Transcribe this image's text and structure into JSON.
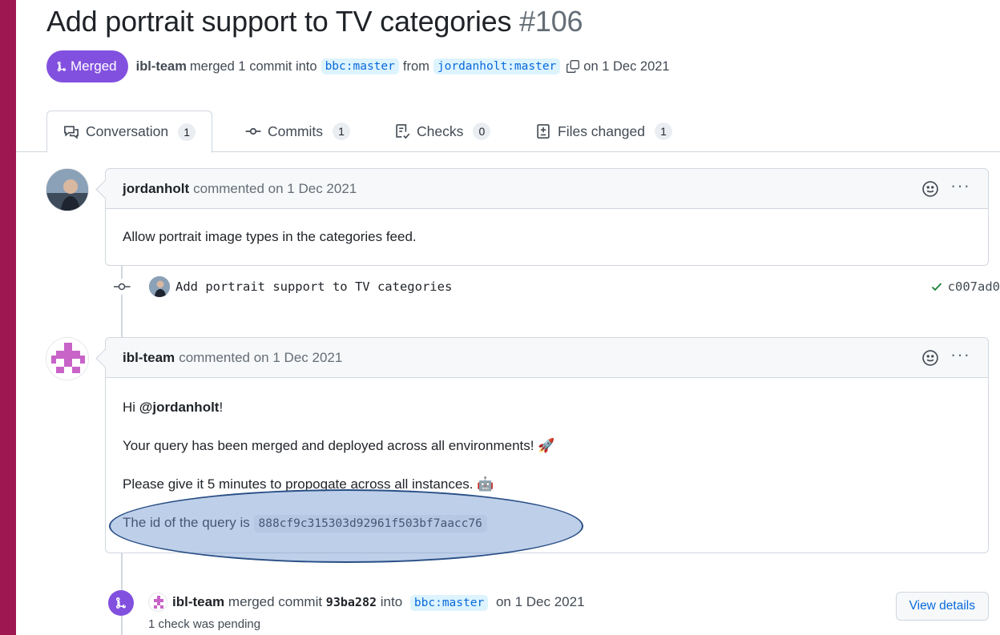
{
  "pr": {
    "title": "Add portrait support to TV categories",
    "number": "#106",
    "state": "Merged",
    "author": "ibl-team",
    "merge_text": "merged 1 commit into",
    "base_branch": "bbc:master",
    "from_text": "from",
    "head_branch": "jordanholt:master",
    "date_text": "on 1 Dec 2021"
  },
  "tabs": [
    {
      "label": "Conversation",
      "count": "1"
    },
    {
      "label": "Commits",
      "count": "1"
    },
    {
      "label": "Checks",
      "count": "0"
    },
    {
      "label": "Files changed",
      "count": "1"
    }
  ],
  "comment1": {
    "author": "jordanholt",
    "meta": "commented on 1 Dec 2021",
    "body": "Allow portrait image types in the categories feed."
  },
  "commit": {
    "message": "Add portrait support to TV categories",
    "sha": "c007ad0",
    "status_color": "#1a7f37"
  },
  "comment2": {
    "author": "ibl-team",
    "meta": "commented on 1 Dec 2021",
    "greeting_prefix": "Hi ",
    "mention": "@jordanholt",
    "greeting_suffix": "!",
    "line2": "Your query has been merged and deployed across all environments!",
    "line2_emoji": "🚀",
    "line3": "Please give it 5 minutes to propogate across all instances.",
    "line3_emoji": "🤖",
    "line4_prefix": "The id of the query is",
    "query_id": "888cf9c315303d92961f503bf7aacc76"
  },
  "merge_event": {
    "actor": "ibl-team",
    "text1": "merged commit",
    "sha": "93ba282",
    "text2": "into",
    "branch": "bbc:master",
    "date": "on 1 Dec 2021",
    "sub": "1 check was pending",
    "button": "View details"
  },
  "colors": {
    "merged_purple": "#8250df",
    "link_blue": "#0969da",
    "frame_magenta": "#9e1750",
    "annotation_fill": "#6e94ce"
  }
}
